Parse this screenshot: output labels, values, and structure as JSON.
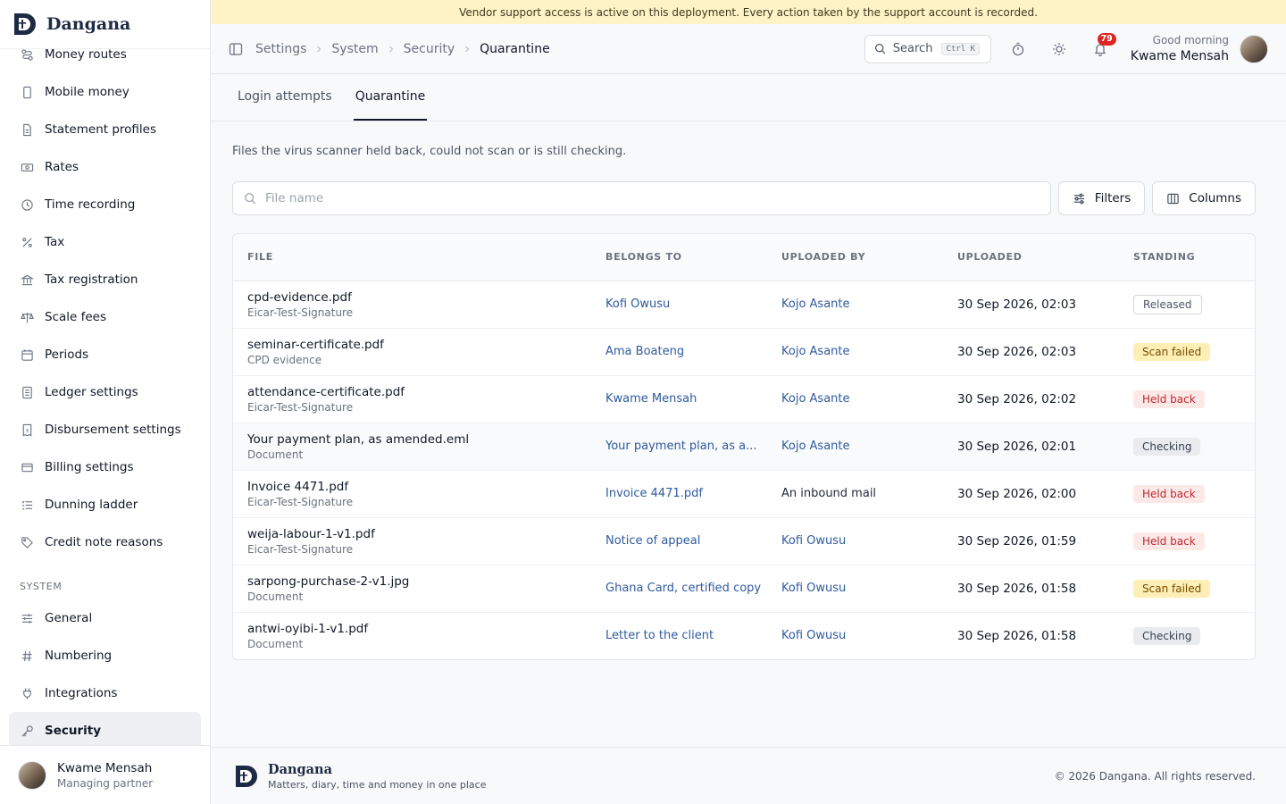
{
  "brand": {
    "name": "Dangana",
    "tagline": "Matters, diary, time and money in one place"
  },
  "sidebar": {
    "items": [
      {
        "label": "Money routes",
        "icon": "route-icon"
      },
      {
        "label": "Mobile money",
        "icon": "phone-icon"
      },
      {
        "label": "Statement profiles",
        "icon": "document-icon"
      },
      {
        "label": "Rates",
        "icon": "banknote-icon"
      },
      {
        "label": "Time recording",
        "icon": "clock-icon"
      },
      {
        "label": "Tax",
        "icon": "percent-icon"
      },
      {
        "label": "Tax registration",
        "icon": "landmark-icon"
      },
      {
        "label": "Scale fees",
        "icon": "scale-icon"
      },
      {
        "label": "Periods",
        "icon": "calendar-icon"
      },
      {
        "label": "Ledger settings",
        "icon": "ledger-icon"
      },
      {
        "label": "Disbursement settings",
        "icon": "receipt-icon"
      },
      {
        "label": "Billing settings",
        "icon": "wallet-icon"
      },
      {
        "label": "Dunning ladder",
        "icon": "list-icon"
      },
      {
        "label": "Credit note reasons",
        "icon": "tag-icon"
      }
    ],
    "system_section": "SYSTEM",
    "system_items": [
      {
        "label": "General",
        "icon": "sliders-icon"
      },
      {
        "label": "Numbering",
        "icon": "hash-icon"
      },
      {
        "label": "Integrations",
        "icon": "plug-icon"
      },
      {
        "label": "Security",
        "icon": "key-icon"
      }
    ],
    "user": {
      "name": "Kwame Mensah",
      "role": "Managing partner"
    }
  },
  "banner": "Vendor support access is active on this deployment. Every action taken by the support account is recorded.",
  "breadcrumb": [
    "Settings",
    "System",
    "Security",
    "Quarantine"
  ],
  "topbar": {
    "search_label": "Search",
    "search_kbd": "Ctrl K",
    "notification_count": "79",
    "greeting": "Good morning",
    "user_name": "Kwame Mensah"
  },
  "tabs": [
    "Login attempts",
    "Quarantine"
  ],
  "description": "Files the virus scanner held back, could not scan or is still checking.",
  "filter": {
    "placeholder": "File name",
    "filters_label": "Filters",
    "columns_label": "Columns"
  },
  "table": {
    "headers": [
      "FILE",
      "BELONGS TO",
      "UPLOADED BY",
      "UPLOADED",
      "STANDING"
    ],
    "rows": [
      {
        "file": "cpd-evidence.pdf",
        "sub": "Eicar-Test-Signature",
        "belongs": "Kofi Owusu",
        "belongs_link": true,
        "uploader": "Kojo Asante",
        "uploader_link": true,
        "date": "30 Sep 2026, 02:03",
        "standing": "Released",
        "kind": "released"
      },
      {
        "file": "seminar-certificate.pdf",
        "sub": "CPD evidence",
        "belongs": "Ama Boateng",
        "belongs_link": true,
        "uploader": "Kojo Asante",
        "uploader_link": true,
        "date": "30 Sep 2026, 02:03",
        "standing": "Scan failed",
        "kind": "failed"
      },
      {
        "file": "attendance-certificate.pdf",
        "sub": "Eicar-Test-Signature",
        "belongs": "Kwame Mensah",
        "belongs_link": true,
        "uploader": "Kojo Asante",
        "uploader_link": true,
        "date": "30 Sep 2026, 02:02",
        "standing": "Held back",
        "kind": "held"
      },
      {
        "file": "Your payment plan, as amended.eml",
        "sub": "Document",
        "belongs": "Your payment plan, as a...",
        "belongs_link": true,
        "uploader": "Kojo Asante",
        "uploader_link": true,
        "date": "30 Sep 2026, 02:01",
        "standing": "Checking",
        "kind": "checking"
      },
      {
        "file": "Invoice 4471.pdf",
        "sub": "Eicar-Test-Signature",
        "belongs": "Invoice 4471.pdf",
        "belongs_link": true,
        "uploader": "An inbound mail",
        "uploader_link": false,
        "date": "30 Sep 2026, 02:00",
        "standing": "Held back",
        "kind": "held"
      },
      {
        "file": "weija-labour-1-v1.pdf",
        "sub": "Eicar-Test-Signature",
        "belongs": "Notice of appeal",
        "belongs_link": true,
        "uploader": "Kofi Owusu",
        "uploader_link": true,
        "date": "30 Sep 2026, 01:59",
        "standing": "Held back",
        "kind": "held"
      },
      {
        "file": "sarpong-purchase-2-v1.jpg",
        "sub": "Document",
        "belongs": "Ghana Card, certified copy",
        "belongs_link": true,
        "uploader": "Kofi Owusu",
        "uploader_link": true,
        "date": "30 Sep 2026, 01:58",
        "standing": "Scan failed",
        "kind": "failed"
      },
      {
        "file": "antwi-oyibi-1-v1.pdf",
        "sub": "Document",
        "belongs": "Letter to the client",
        "belongs_link": true,
        "uploader": "Kofi Owusu",
        "uploader_link": true,
        "date": "30 Sep 2026, 01:58",
        "standing": "Checking",
        "kind": "checking"
      }
    ]
  },
  "footer": {
    "copyright": "© 2026 Dangana. All rights reserved."
  },
  "colors": {
    "banner": "#fdf3c7",
    "link": "#2f5a9e",
    "held": "#c0262d",
    "failed_bg": "#fdefb5",
    "badge": "#dc2626"
  }
}
